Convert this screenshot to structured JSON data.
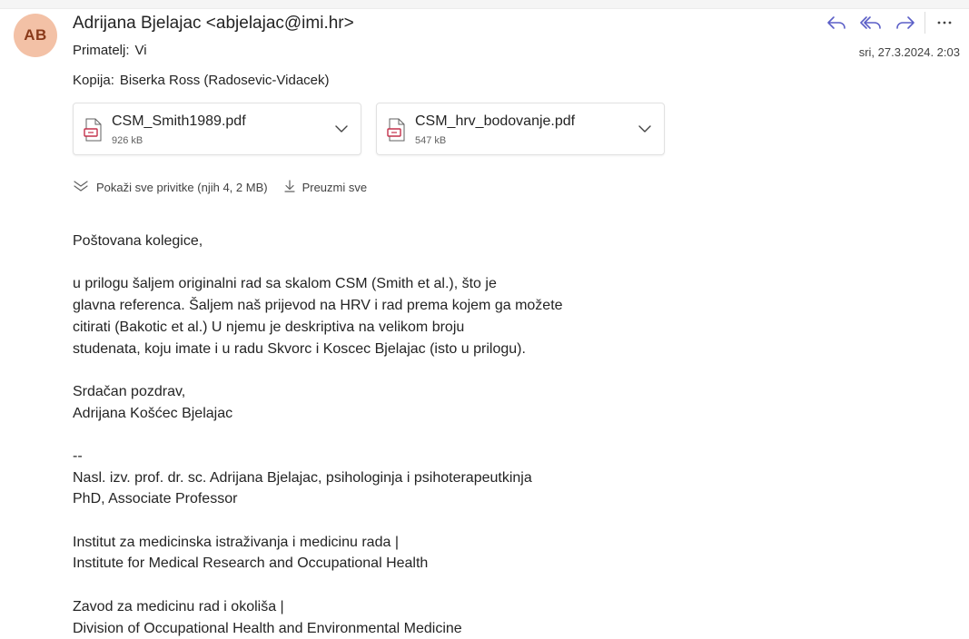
{
  "sender": {
    "initials": "AB",
    "display": "Adrijana Bjelajac <abjelajac@imi.hr>",
    "avatar_color": "#f3c1a6"
  },
  "recipients": {
    "to_label": "Primatelj:",
    "to_value": "Vi",
    "cc_label": "Kopija:",
    "cc_value": "Biserka Ross (Radosevic-Vidacek)"
  },
  "date": "sri, 27.3.2024. 2:03",
  "actions": {
    "icons": [
      "reply-icon",
      "reply-all-icon",
      "forward-icon",
      "more-icon"
    ],
    "accent": "#5b5fc7"
  },
  "attachments": [
    {
      "name": "CSM_Smith1989.pdf",
      "size": "926 kB",
      "icon": "pdf-icon"
    },
    {
      "name": "CSM_hrv_bodovanje.pdf",
      "size": "547 kB",
      "icon": "pdf-icon"
    }
  ],
  "attachment_links": {
    "show_all": "Pokaži sve privitke (njih 4, 2 MB)",
    "download_all": "Preuzmi sve"
  },
  "body": {
    "greeting": "Poštovana kolegice,",
    "paragraph": "u prilogu šaljem originalni rad sa skalom CSM (Smith et al.), što je\nglavna referenca. Šaljem naš prijevod na HRV i rad prema kojem ga možete\ncitirati (Bakotic et al.) U njemu je deskriptiva na velikom broju\nstudenata, koju imate i u radu Skvorc i Koscec Bjelajac (isto u prilogu).",
    "closing": "Srdačan pozdrav,\nAdrijana Košćec Bjelajac",
    "signature_sep": "--",
    "signature_title": "Nasl. izv. prof. dr. sc. Adrijana Bjelajac, psihologinja i psihoterapeutkinja\nPhD, Associate Professor",
    "institute": "Institut za medicinska istraživanja i medicinu rada |\nInstitute for Medical Research and Occupational Health",
    "division": "Zavod za medicinu rad i okoliša |\nDivision of Occupational Health and Environmental Medicine"
  }
}
